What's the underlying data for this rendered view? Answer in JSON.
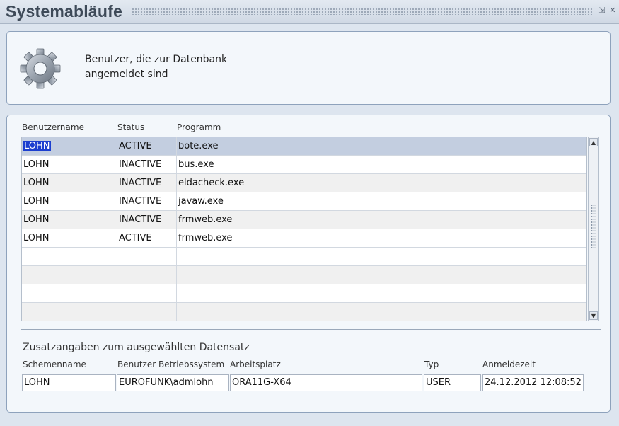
{
  "window": {
    "title": "Systemabläufe",
    "minimize_glyph": "⇲",
    "close_glyph": "✕"
  },
  "info": {
    "icon": "gear-icon",
    "text_line1": "Benutzer, die zur Datenbank",
    "text_line2": "angemeldet sind"
  },
  "table": {
    "headers": [
      "Benutzername",
      "Status",
      "Programm"
    ],
    "rows": [
      {
        "user": "LOHN",
        "status": "ACTIVE",
        "program": "bote.exe"
      },
      {
        "user": "LOHN",
        "status": "INACTIVE",
        "program": "bus.exe"
      },
      {
        "user": "LOHN",
        "status": "INACTIVE",
        "program": "eldacheck.exe"
      },
      {
        "user": "LOHN",
        "status": "INACTIVE",
        "program": "javaw.exe"
      },
      {
        "user": "LOHN",
        "status": "INACTIVE",
        "program": "frmweb.exe"
      },
      {
        "user": "LOHN",
        "status": "ACTIVE",
        "program": "frmweb.exe"
      },
      {
        "user": "",
        "status": "",
        "program": ""
      },
      {
        "user": "",
        "status": "",
        "program": ""
      },
      {
        "user": "",
        "status": "",
        "program": ""
      },
      {
        "user": "",
        "status": "",
        "program": ""
      }
    ],
    "selected_row": 0
  },
  "details": {
    "section_title": "Zusatzangaben zum ausgewählten Datensatz",
    "labels": {
      "schema": "Schemenname",
      "os_user": "Benutzer Betriebssystem",
      "workstation": "Arbeitsplatz",
      "type": "Typ",
      "login_time": "Anmeldezeit"
    },
    "values": {
      "schema": "LOHN",
      "os_user": "EUROFUNK\\admlohn",
      "workstation": "ORA11G-X64",
      "type": "USER",
      "login_time": "24.12.2012 12:08:52"
    }
  },
  "colors": {
    "selection_row": "#c3cee0",
    "selection_text": "#1c3fcf",
    "panel_border": "#8ea2bc"
  }
}
